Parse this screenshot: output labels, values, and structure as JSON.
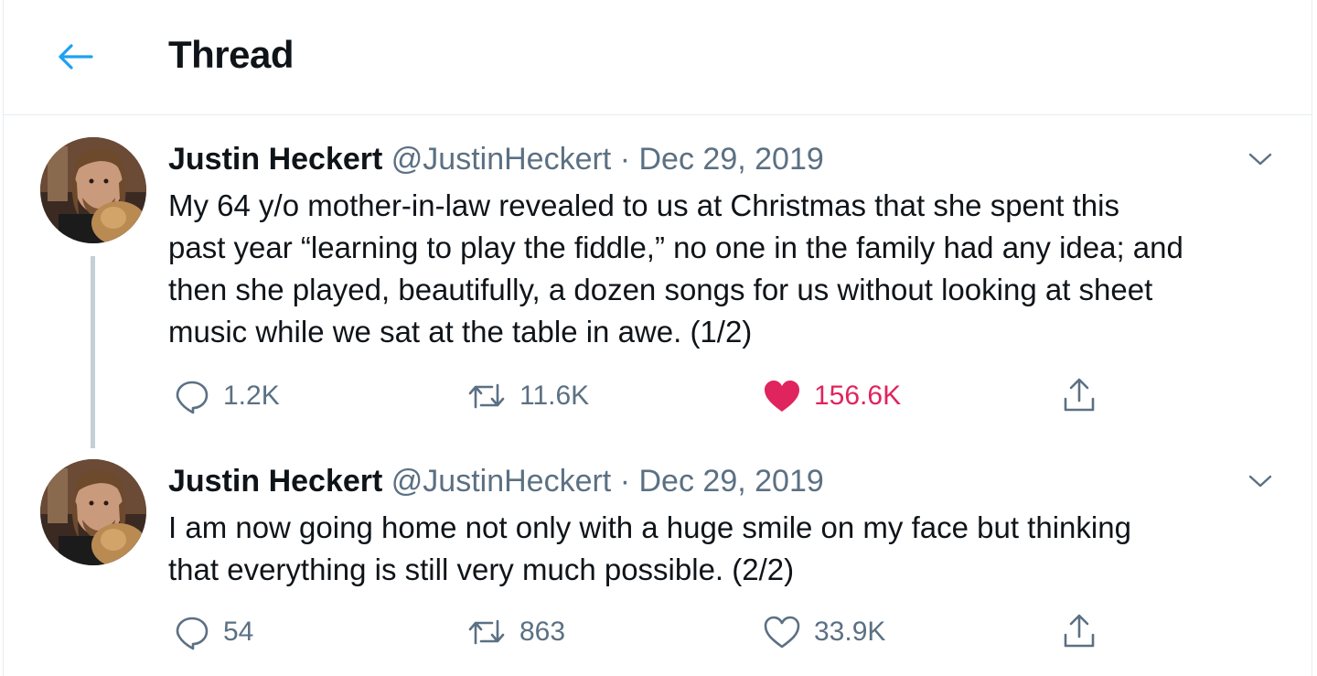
{
  "header": {
    "title": "Thread"
  },
  "tweets": [
    {
      "name": "Justin Heckert",
      "handle": "@JustinHeckert",
      "separator": "·",
      "date": "Dec 29, 2019",
      "text": "My 64 y/o mother-in-law revealed to us at Christmas that she spent this\npast year “learning to play the fiddle,” no one in the family had any idea; and\nthen she played, beautifully, a dozen songs for us without looking at sheet\nmusic while we sat at the table in awe. (1/2)",
      "replies": "1.2K",
      "retweets": "11.6K",
      "likes": "156.6K",
      "liked": true
    },
    {
      "name": "Justin Heckert",
      "handle": "@JustinHeckert",
      "separator": "·",
      "date": "Dec 29, 2019",
      "text": "I am now going home not only with a huge smile on my face but thinking\nthat everything is still very much possible. (2/2)",
      "replies": "54",
      "retweets": "863",
      "likes": "33.9K",
      "liked": false
    }
  ],
  "colors": {
    "accent": "#1da1f2",
    "like": "#e0245e",
    "secondary": "#5b7083",
    "divider": "#e6ecf0"
  }
}
